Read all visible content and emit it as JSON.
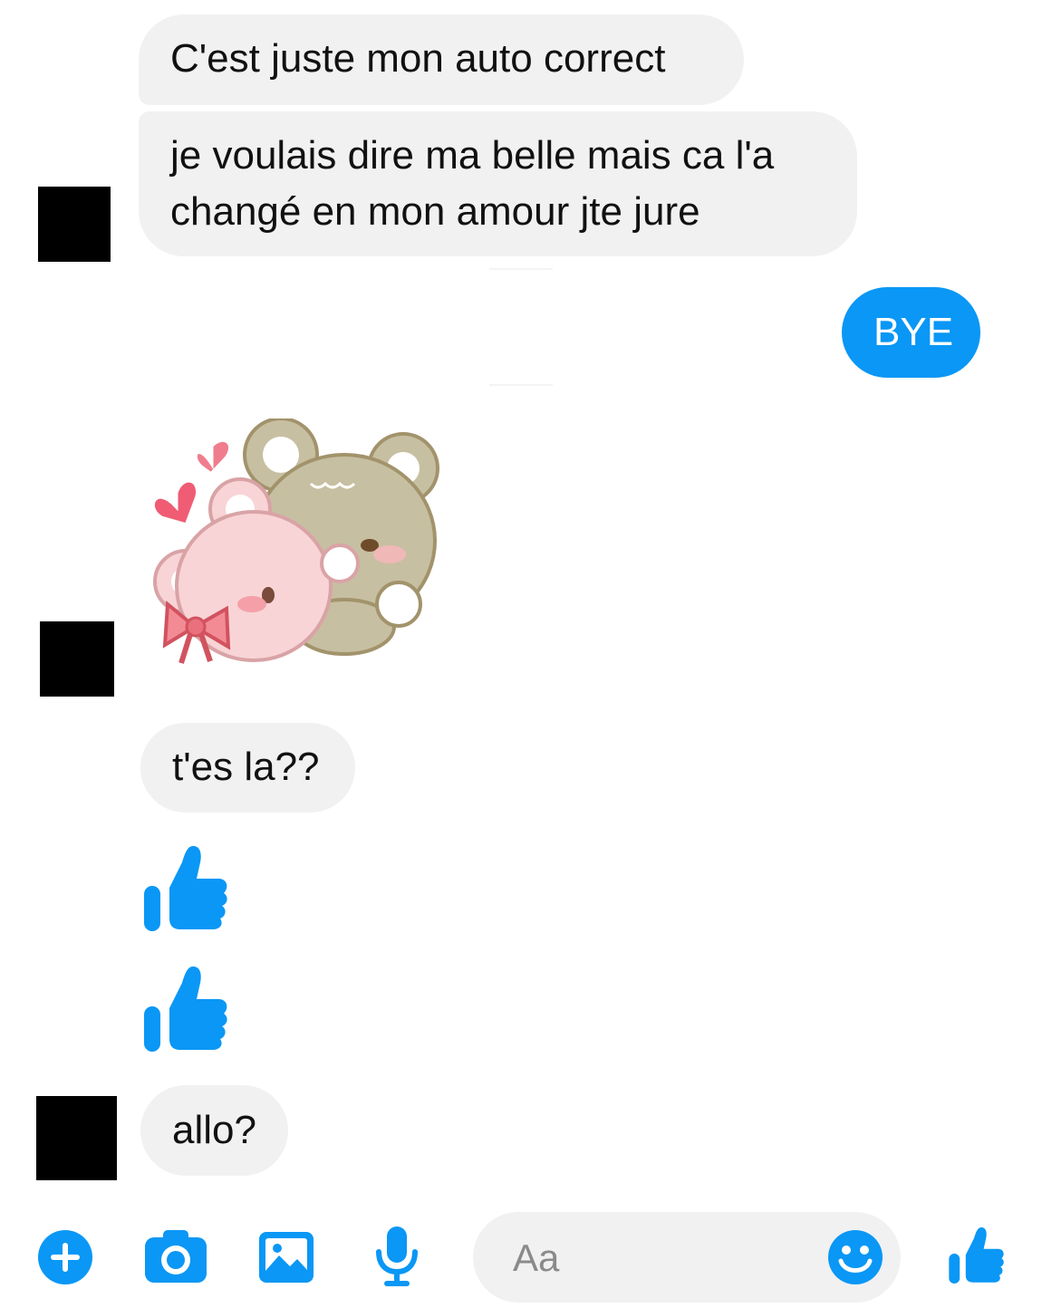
{
  "messages": [
    {
      "id": "m1",
      "sender": "them",
      "text": "C'est juste mon auto correct"
    },
    {
      "id": "m2",
      "sender": "them",
      "lines": [
        "je voulais dire ma belle mais ca l'a",
        "changé en mon amour jte jure"
      ]
    },
    {
      "id": "m3",
      "sender": "me",
      "text": "BYE"
    },
    {
      "id": "m4",
      "sender": "them",
      "sticker": "bears-hug-sticker"
    },
    {
      "id": "m5",
      "sender": "them",
      "text": "t'es la??"
    },
    {
      "id": "m6",
      "sender": "them",
      "icon": "thumbs-up-icon"
    },
    {
      "id": "m7",
      "sender": "them",
      "icon": "thumbs-up-icon"
    },
    {
      "id": "m8",
      "sender": "them",
      "text": "allo?"
    }
  ],
  "composer": {
    "placeholder": "Aa",
    "icons": [
      "plus-icon",
      "camera-icon",
      "image-icon",
      "microphone-icon",
      "emoji-icon",
      "thumbs-up-icon"
    ]
  },
  "colors": {
    "accent": "#0a97f5",
    "bubble_other": "#f1f1f1",
    "avatar_redaction": "#000000"
  }
}
